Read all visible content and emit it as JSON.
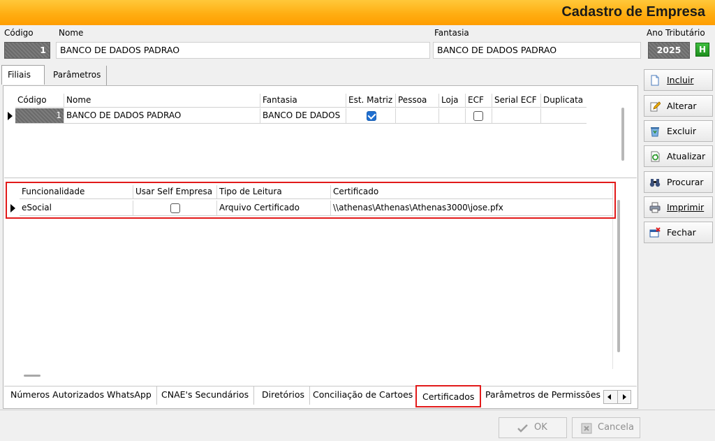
{
  "window": {
    "title": "Cadastro de Empresa"
  },
  "header": {
    "codigo_label": "Código",
    "codigo_value": "1",
    "nome_label": "Nome",
    "nome_value": "BANCO DE DADOS PADRAO",
    "fantasia_label": "Fantasia",
    "fantasia_value": "BANCO DE DADOS PADRAO",
    "ano_label": "Ano Tributário",
    "ano_value": "2025",
    "ano_button": "H"
  },
  "top_tabs": [
    "Filiais",
    "Parâmetros"
  ],
  "filiais_grid": {
    "columns": [
      "Código",
      "Nome",
      "Fantasia",
      "Est. Matriz",
      "Pessoa",
      "Loja",
      "ECF",
      "Serial ECF",
      "Duplicata"
    ],
    "row": {
      "codigo": "1",
      "nome": "BANCO DE DADOS PADRAO",
      "fantasia": "BANCO DE DADOS",
      "est_matriz": true,
      "ecf": false
    }
  },
  "cert_grid": {
    "columns": [
      "Funcionalidade",
      "Usar Self Empresa",
      "Tipo de Leitura",
      "Certificado"
    ],
    "row": {
      "funcionalidade": "eSocial",
      "usar_self": false,
      "tipo": "Arquivo Certificado",
      "certificado": "\\\\athenas\\Athenas\\Athenas3000\\jose.pfx"
    }
  },
  "bottom_tabs": [
    "Números Autorizados WhatsApp",
    "CNAE's Secundários",
    "Diretórios",
    "Conciliação de Cartoes",
    "Certificados",
    "Parâmetros de Permissões I"
  ],
  "side_buttons": [
    "Incluir",
    "Alterar",
    "Excluir",
    "Atualizar",
    "Procurar",
    "Imprimir",
    "Fechar"
  ],
  "footer": {
    "ok": "OK",
    "cancel": "Cancela"
  },
  "colors": {
    "title_bar": "#ffae12",
    "highlight": "#e21a1a",
    "check": "#1f6fd0"
  }
}
